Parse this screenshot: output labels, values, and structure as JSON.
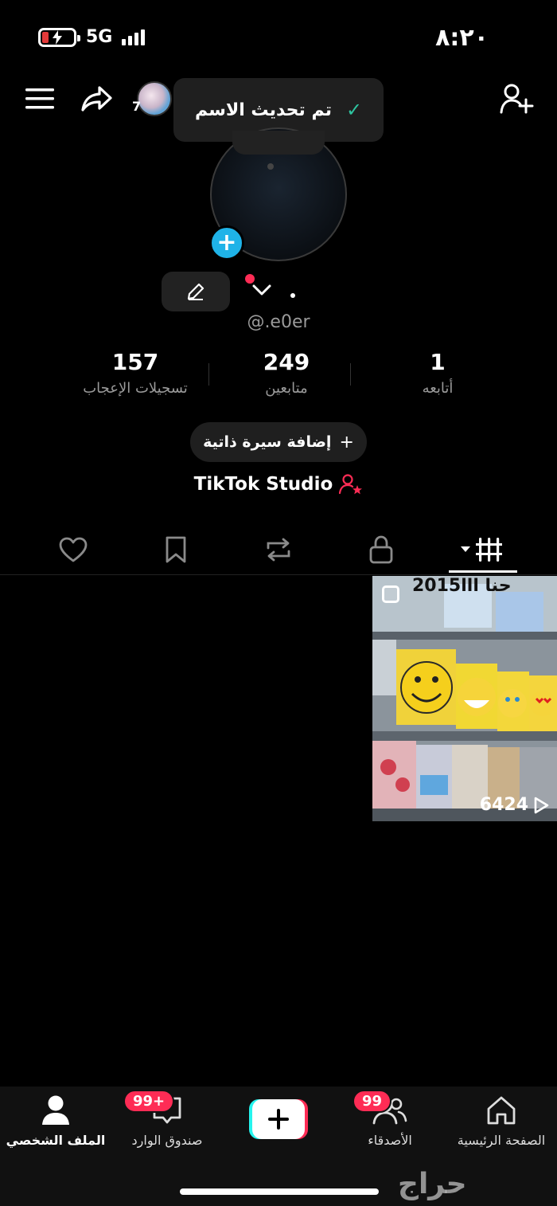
{
  "status_bar": {
    "time": "٨:٢٠",
    "network": "5G"
  },
  "toast": {
    "text": "تم تحديث الاسم"
  },
  "header": {
    "avatar_count": "7"
  },
  "profile": {
    "username": "@.e0er",
    "name": "."
  },
  "stats": [
    {
      "value": "157",
      "label": "تسجيلات الإعجاب"
    },
    {
      "value": "249",
      "label": "متابعين"
    },
    {
      "value": "1",
      "label": "أتابعه"
    }
  ],
  "bio_button": {
    "label": "إضافة سيرة ذاتية"
  },
  "studio": {
    "label": "TikTok Studio"
  },
  "video": {
    "title": "2015حنا ااا",
    "views": "6424"
  },
  "bottom_nav": {
    "profile": "الملف الشخصي",
    "inbox": "صندوق الوارد",
    "inbox_badge": "99+",
    "friends": "الأصدقاء",
    "friends_badge": "99",
    "home": "الصفحة الرئيسية"
  },
  "watermark": "حراج",
  "colors": {
    "accent_red": "#fe2c55",
    "accent_cyan": "#1fb3e8",
    "toast_check": "#2ec4a0"
  }
}
